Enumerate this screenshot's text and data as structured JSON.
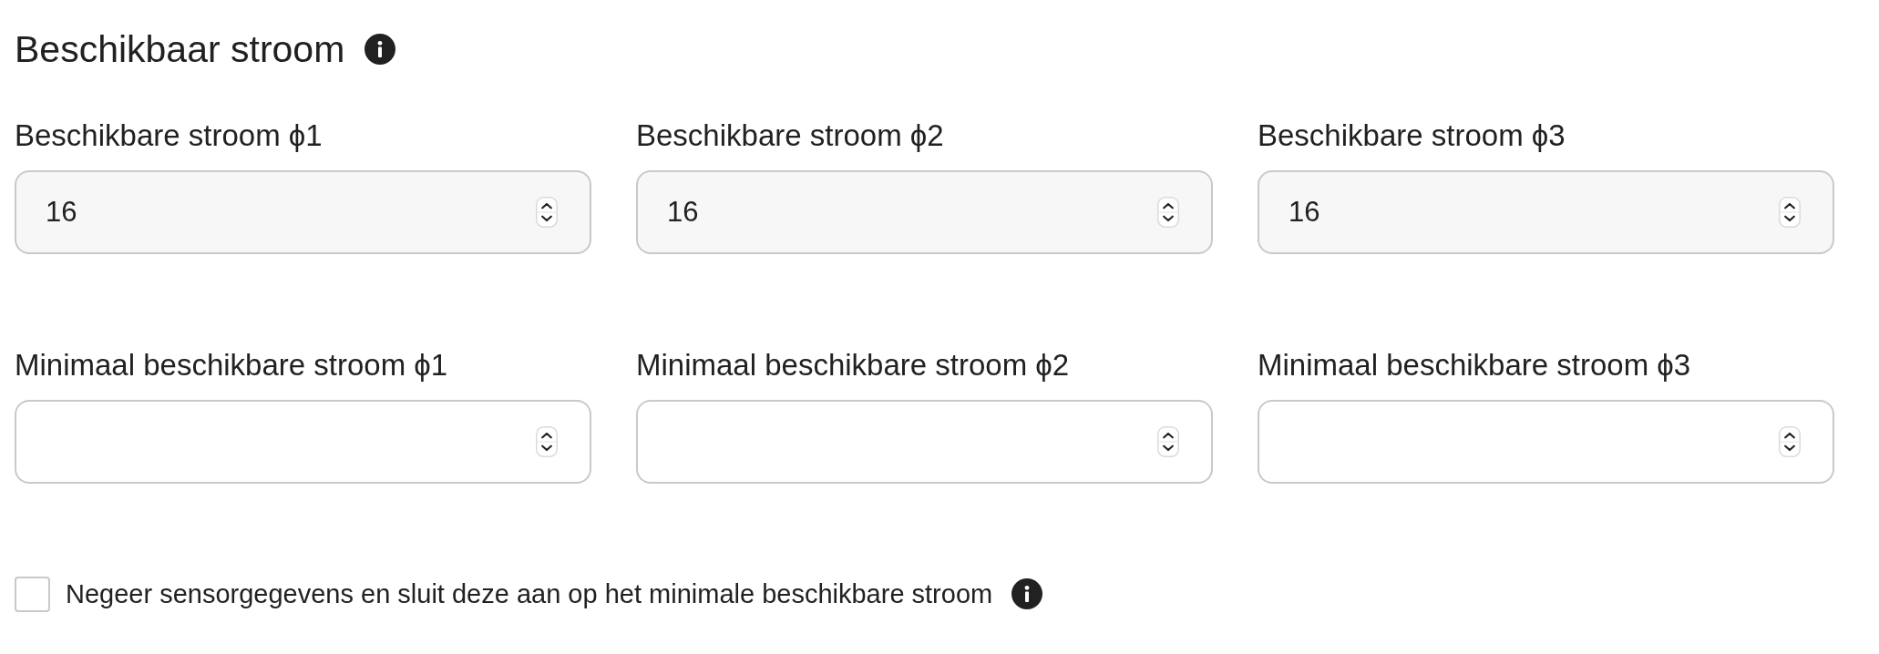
{
  "section": {
    "title": "Beschikbaar stroom"
  },
  "field_rows": [
    {
      "fields": [
        {
          "label": "Beschikbare stroom ϕ1",
          "value": "16"
        },
        {
          "label": "Beschikbare stroom ϕ2",
          "value": "16"
        },
        {
          "label": "Beschikbare stroom ϕ3",
          "value": "16"
        }
      ]
    },
    {
      "fields": [
        {
          "label": "Minimaal beschikbare stroom ϕ1"
        },
        {
          "label": "Minimaal beschikbare stroom ϕ2"
        },
        {
          "label": "Minimaal beschikbare stroom ϕ3"
        }
      ]
    }
  ],
  "checkbox": {
    "label": "Negeer sensorgegevens en sluit deze aan op het minimale beschikbare stroom",
    "checked": false
  }
}
